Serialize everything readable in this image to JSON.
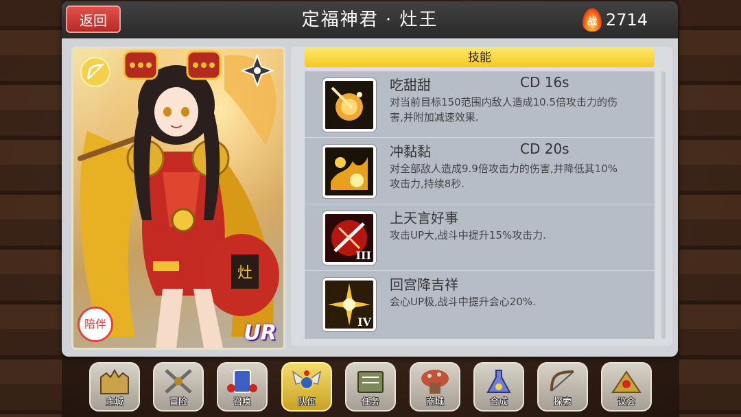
{
  "header": {
    "back_label": "返回",
    "title": "定福神君 · 灶王",
    "power_glyph": "战",
    "power_value": "2714"
  },
  "card": {
    "class_icon": "bow-icon",
    "element_icon": "wind-shuriken-icon",
    "companion_label": "陪伴",
    "rarity": "UR"
  },
  "skills": {
    "header": "技能",
    "items": [
      {
        "name": "吃甜甜",
        "cd": "CD  16s",
        "desc": "对当前目标150范围内敌人造成10.5倍攻击力的伤害,并附加减速效果.",
        "rank": "",
        "icon": "golden-orb-icon"
      },
      {
        "name": "冲黏黏",
        "cd": "CD  20s",
        "desc": "对全部敌人造成9.9倍攻击力的伤害,并降低其10%攻击力,持续8秒.",
        "rank": "",
        "icon": "golden-splash-icon"
      },
      {
        "name": "上天言好事",
        "cd": "",
        "desc": "攻击UP大,战斗中提升15%攻击力.",
        "rank": "III",
        "icon": "red-slash-icon"
      },
      {
        "name": "回宫降吉祥",
        "cd": "",
        "desc": "会心UP极,战斗中提升会心20%.",
        "rank": "IV",
        "icon": "golden-burst-icon"
      }
    ]
  },
  "nav": [
    {
      "label": "主城",
      "icon": "castle-icon"
    },
    {
      "label": "冒险",
      "icon": "crossed-swords-icon"
    },
    {
      "label": "召唤",
      "icon": "summon-card-icon"
    },
    {
      "label": "队伍",
      "icon": "team-wings-icon",
      "active": true
    },
    {
      "label": "任务",
      "icon": "quest-book-icon"
    },
    {
      "label": "商城",
      "icon": "shop-mushroom-icon"
    },
    {
      "label": "合成",
      "icon": "synthesis-flask-icon"
    },
    {
      "label": "探索",
      "icon": "explore-bow-icon"
    },
    {
      "label": "议会",
      "icon": "council-icon"
    }
  ],
  "colors": {
    "back_button": "#d43c36",
    "header_bar": "#2f2f2f",
    "skills_header": "#f4c820",
    "active_nav": "#e6c440"
  }
}
